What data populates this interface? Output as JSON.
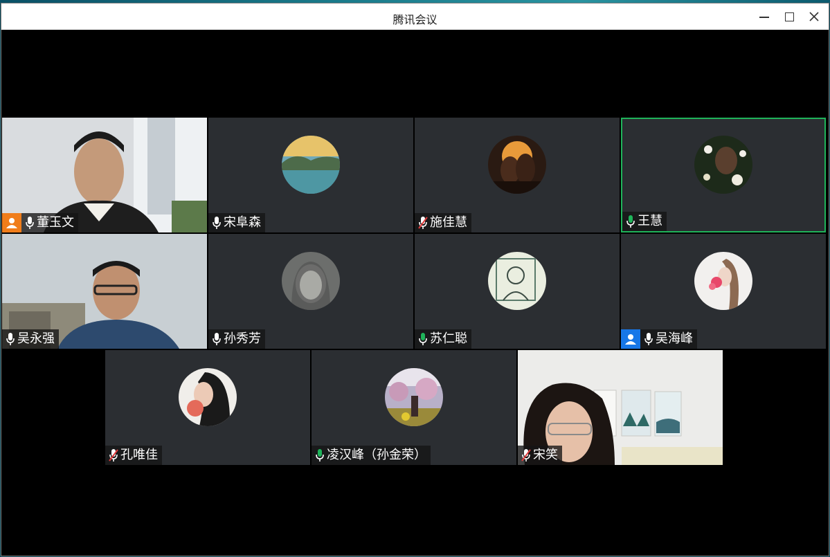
{
  "window": {
    "title": "腾讯会议"
  },
  "participants": [
    {
      "name": "董玉文",
      "mic": "on",
      "badge": "host"
    },
    {
      "name": "宋阜森",
      "mic": "on"
    },
    {
      "name": "施佳慧",
      "mic": "muted"
    },
    {
      "name": "王慧",
      "mic": "speaking",
      "active": true
    },
    {
      "name": "吴永强",
      "mic": "on"
    },
    {
      "name": "孙秀芳",
      "mic": "on"
    },
    {
      "name": "苏仁聪",
      "mic": "speaking"
    },
    {
      "name": "吴海峰",
      "mic": "on",
      "badge": "cohost"
    },
    {
      "name": "孔唯佳",
      "mic": "muted"
    },
    {
      "name": "凌汉峰（孙金荣）",
      "mic": "speaking"
    },
    {
      "name": "宋笑",
      "mic": "muted"
    }
  ],
  "colors": {
    "speaking": "#1fb45a",
    "muted": "#e03c3c",
    "host": "#f07d1a",
    "cohost": "#1777e8",
    "tile": "#2b2e32"
  },
  "icons": {
    "minimize": "minimize-icon",
    "maximize": "maximize-icon",
    "close": "close-icon",
    "mic": "microphone-icon",
    "mic_muted": "microphone-muted-icon",
    "host": "person-badge-icon"
  }
}
